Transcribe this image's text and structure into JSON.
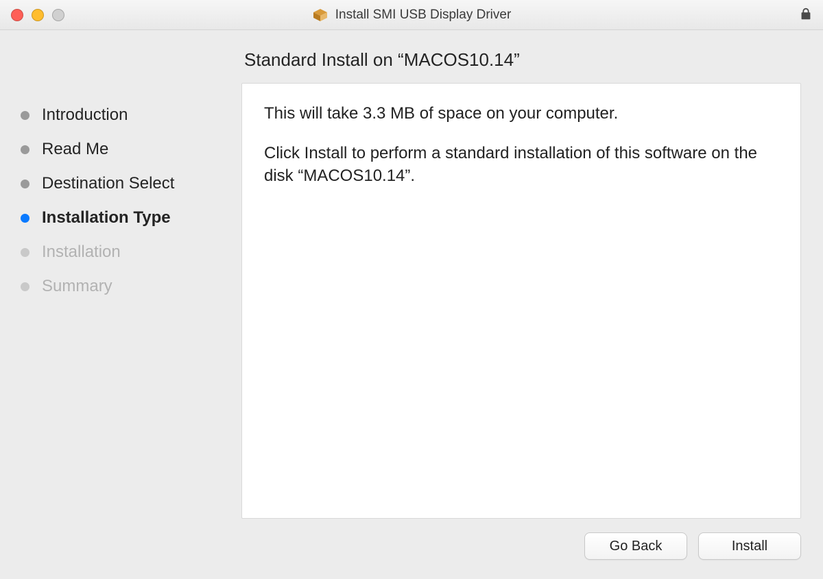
{
  "window": {
    "title": "Install SMI USB Display Driver"
  },
  "sidebar": {
    "steps": [
      {
        "label": "Introduction",
        "state": "done"
      },
      {
        "label": "Read Me",
        "state": "done"
      },
      {
        "label": "Destination Select",
        "state": "done"
      },
      {
        "label": "Installation Type",
        "state": "current"
      },
      {
        "label": "Installation",
        "state": "upcoming"
      },
      {
        "label": "Summary",
        "state": "upcoming"
      }
    ]
  },
  "main": {
    "heading": "Standard Install on “MACOS10.14”",
    "body_line1": "This will take 3.3 MB of space on your computer.",
    "body_line2": "Click Install to perform a standard installation of this software on the disk “MACOS10.14”."
  },
  "buttons": {
    "back": "Go Back",
    "install": "Install"
  }
}
